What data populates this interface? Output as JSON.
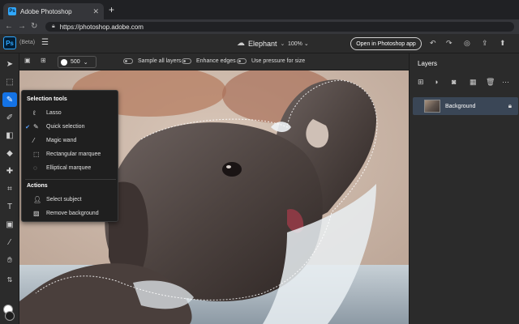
{
  "browser": {
    "tab_title": "Adobe Photoshop",
    "tab_icon": "Ps",
    "new_tab": "+",
    "close": "✕",
    "url": "https://photoshop.adobe.com"
  },
  "app": {
    "logo": "Ps",
    "beta": "(Beta)",
    "document_name": "Elephant",
    "zoom": "100%",
    "open_button": "Open in Photoshop app"
  },
  "options": {
    "brush_size": "500",
    "sample_all_layers": "Sample all layers",
    "enhance_edges": "Enhance edges",
    "use_pressure": "Use pressure for size"
  },
  "flyout": {
    "section1": "Selection tools",
    "items": [
      {
        "label": "Lasso",
        "selected": false
      },
      {
        "label": "Quick selection",
        "selected": true
      },
      {
        "label": "Magic wand",
        "selected": false
      },
      {
        "label": "Rectangular marquee",
        "selected": false
      },
      {
        "label": "Elliptical marquee",
        "selected": false
      }
    ],
    "section2": "Actions",
    "actions": [
      {
        "label": "Select subject"
      },
      {
        "label": "Remove background"
      }
    ]
  },
  "layers": {
    "title": "Layers",
    "items": [
      {
        "name": "Background",
        "locked": true
      }
    ]
  },
  "colors": {
    "accent": "#1473e6",
    "panel": "#2b2b2b",
    "foreground": "#ffffff",
    "background": "#1e1e1e"
  }
}
